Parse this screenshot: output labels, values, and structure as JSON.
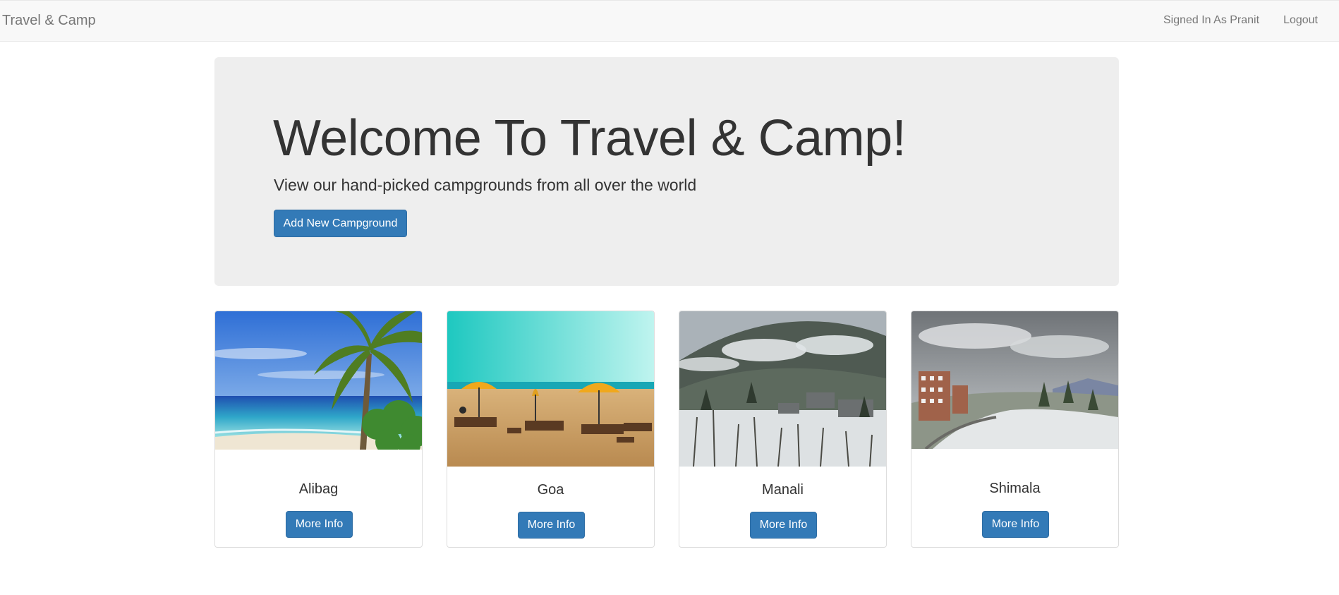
{
  "navbar": {
    "brand": "Travel & Camp",
    "signed_in": "Signed In As Pranit",
    "logout": "Logout"
  },
  "hero": {
    "title": "Welcome To Travel & Camp!",
    "subtitle": "View our hand-picked campgrounds from all over the world",
    "add_button": "Add New Campground"
  },
  "campgrounds": [
    {
      "name": "Alibag",
      "button": "More Info",
      "image": "tropical-beach-palm-photo"
    },
    {
      "name": "Goa",
      "button": "More Info",
      "image": "beach-umbrellas-photo"
    },
    {
      "name": "Manali",
      "button": "More Info",
      "image": "snowy-mountain-village-photo"
    },
    {
      "name": "Shimala",
      "button": "More Info",
      "image": "snowy-hill-town-photo"
    }
  ],
  "colors": {
    "primary": "#337ab7",
    "navbar_bg": "#f8f8f8",
    "jumbotron_bg": "#eeeeee"
  }
}
